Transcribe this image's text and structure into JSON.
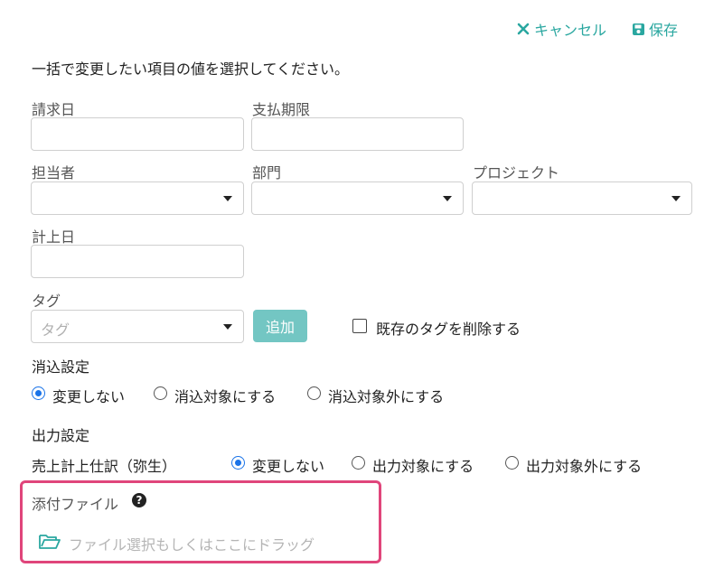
{
  "header": {
    "cancel_label": "キャンセル",
    "save_label": "保存"
  },
  "instruction": "一括で変更したい項目の値を選択してください。",
  "fields": {
    "invoice_date": {
      "label": "請求日",
      "value": ""
    },
    "payment_due": {
      "label": "支払期限",
      "value": ""
    },
    "assignee": {
      "label": "担当者",
      "value": ""
    },
    "department": {
      "label": "部門",
      "value": ""
    },
    "project": {
      "label": "プロジェクト",
      "value": ""
    },
    "posting_date": {
      "label": "計上日",
      "value": ""
    },
    "tag": {
      "label": "タグ",
      "placeholder": "タグ",
      "add_label": "追加",
      "delete_existing_label": "既存のタグを削除する",
      "delete_existing_checked": false
    }
  },
  "reconcile": {
    "label": "消込設定",
    "options": [
      "変更しない",
      "消込対象にする",
      "消込対象外にする"
    ],
    "selected": "変更しない"
  },
  "output": {
    "label": "出力設定",
    "row_label": "売上計上仕訳（弥生）",
    "options": [
      "変更しない",
      "出力対象にする",
      "出力対象外にする"
    ],
    "selected": "変更しない"
  },
  "attachment": {
    "label": "添付ファイル",
    "drop_placeholder": "ファイル選択もしくはここにドラッグ"
  },
  "colors": {
    "accent": "#2aa7a0",
    "add_button": "#73c6c3",
    "radio_selected": "#1a73e8",
    "highlight_border": "#e0457b"
  },
  "icons": {
    "cancel": "close-icon",
    "save": "floppy-disk-icon",
    "help": "question-circle-icon",
    "folder": "folder-open-icon"
  }
}
